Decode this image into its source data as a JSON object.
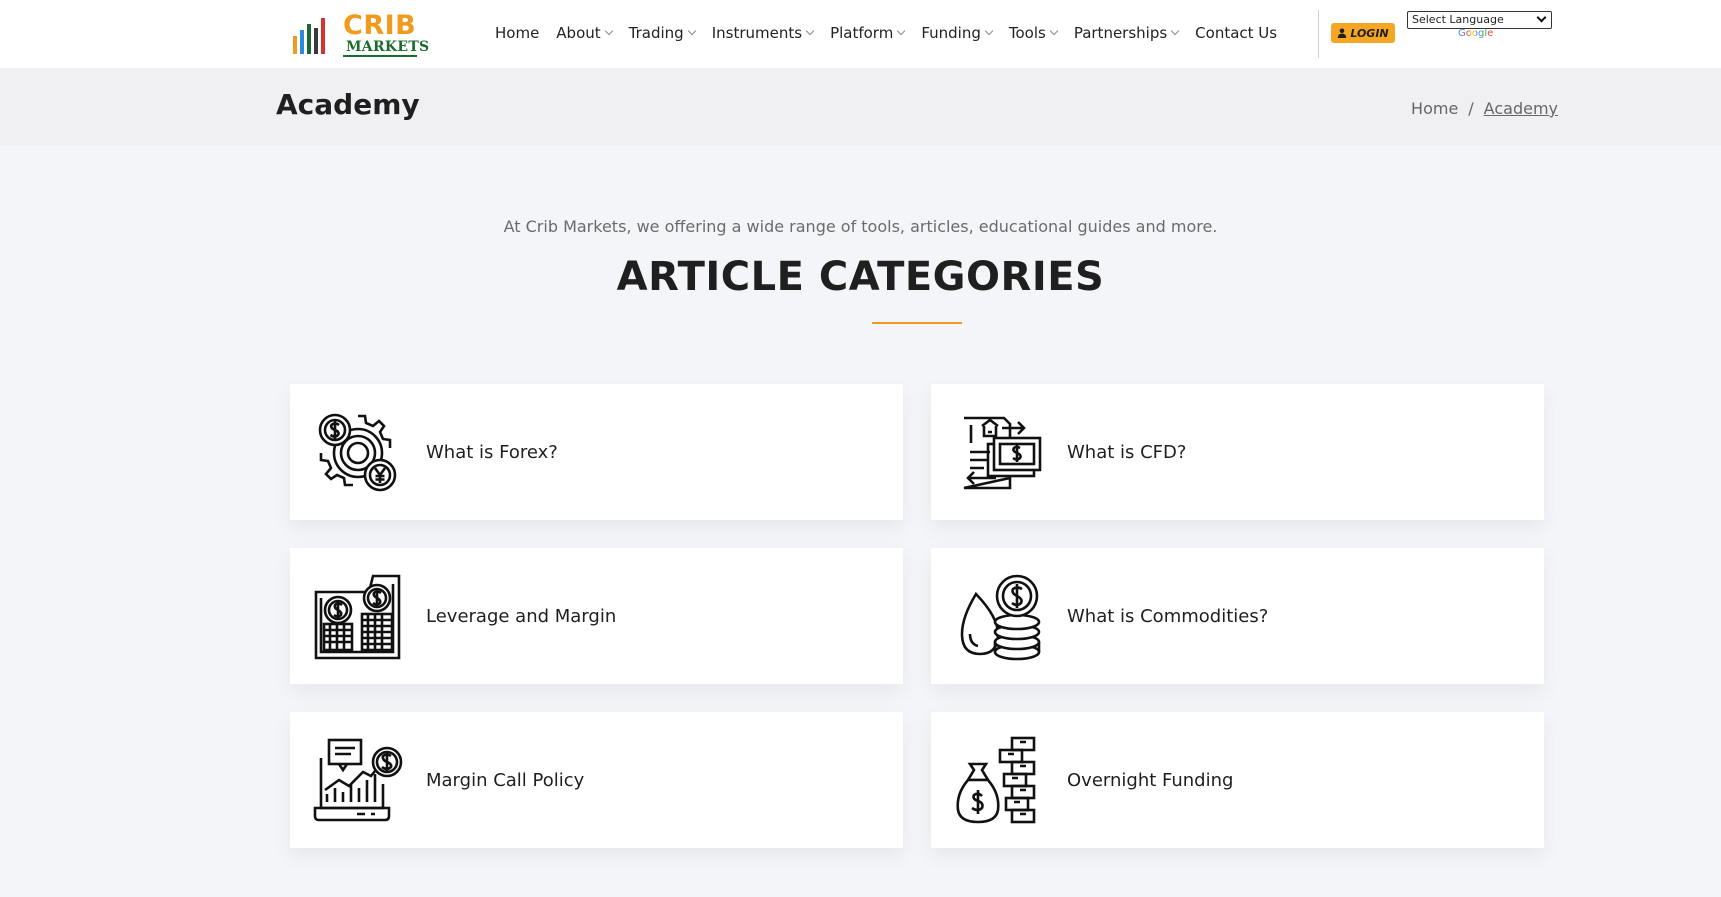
{
  "brand": {
    "name_top": "CRIB",
    "name_bottom": "MARKETS",
    "colors": {
      "orange": "#f29a1b",
      "green": "#1a6b2d"
    }
  },
  "nav": {
    "items": [
      {
        "label": "Home",
        "dropdown": false
      },
      {
        "label": "About",
        "dropdown": true
      },
      {
        "label": "Trading",
        "dropdown": true
      },
      {
        "label": "Instruments",
        "dropdown": true
      },
      {
        "label": "Platform",
        "dropdown": true
      },
      {
        "label": "Funding",
        "dropdown": true
      },
      {
        "label": "Tools",
        "dropdown": true
      },
      {
        "label": "Partnerships",
        "dropdown": true
      },
      {
        "label": "Contact Us",
        "dropdown": false
      }
    ],
    "login_label": "LOGIN",
    "language_select": "Select Language",
    "google_label": "Google"
  },
  "page": {
    "title": "Academy",
    "breadcrumb": {
      "home": "Home",
      "separator": "/",
      "current": "Academy"
    }
  },
  "intro": {
    "text": "At Crib Markets, we offering a wide range of tools, articles, educational guides and more.",
    "heading": "ARTICLE CATEGORIES"
  },
  "categories": [
    {
      "label": "What is Forex?",
      "icon": "forex-gears-coins-icon"
    },
    {
      "label": "What is CFD?",
      "icon": "cfd-document-exchange-icon"
    },
    {
      "label": "Leverage and Margin",
      "icon": "leverage-coin-stacks-icon"
    },
    {
      "label": "What is Commodities?",
      "icon": "commodities-oil-drop-coins-icon"
    },
    {
      "label": "Margin Call Policy",
      "icon": "margin-call-laptop-chart-icon"
    },
    {
      "label": "Overnight Funding",
      "icon": "overnight-money-bag-icon"
    }
  ]
}
